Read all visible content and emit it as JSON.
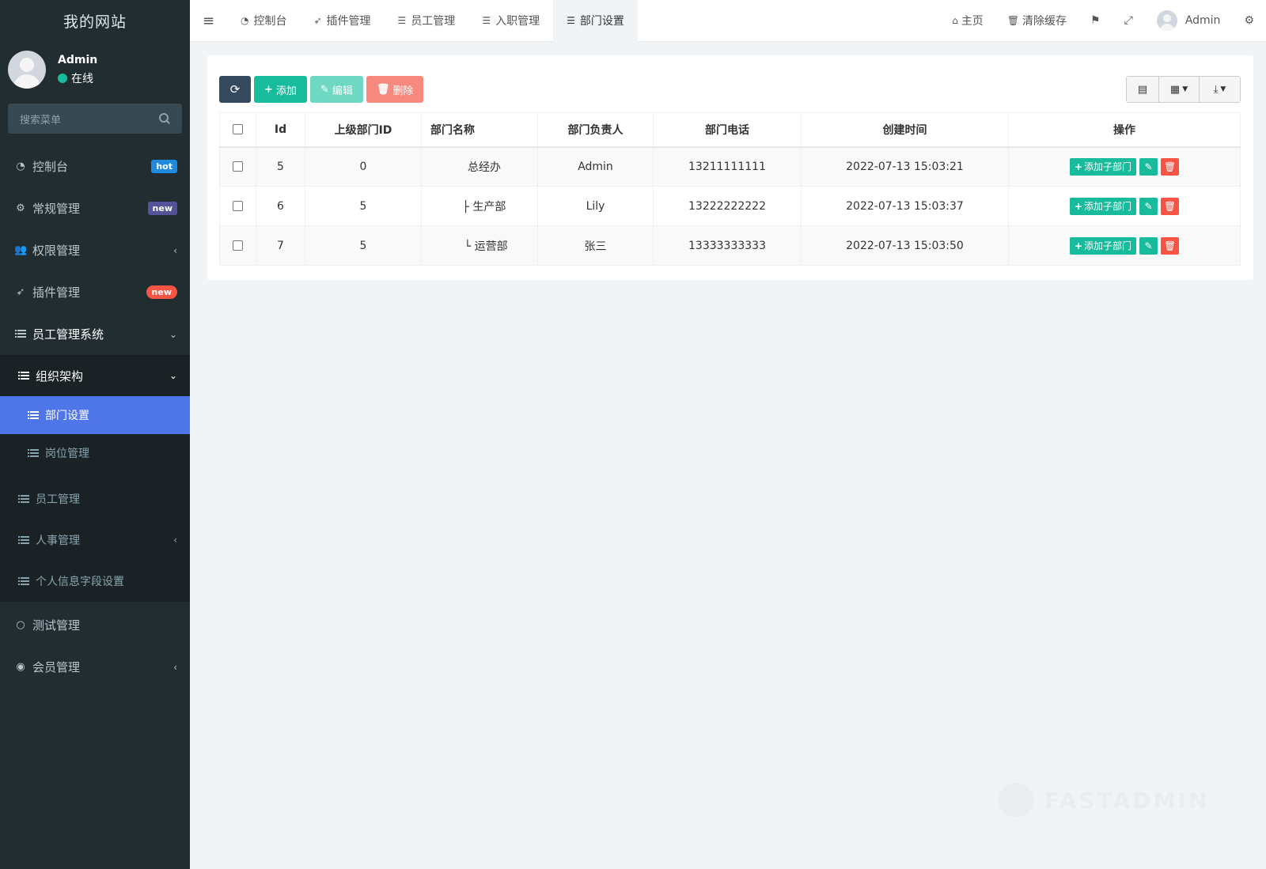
{
  "site": {
    "title": "我的网站"
  },
  "user": {
    "name": "Admin",
    "status": "在线"
  },
  "search": {
    "placeholder": "搜索菜单"
  },
  "sidebar": {
    "items": [
      {
        "label": "控制台",
        "icon": "dashboard-icon",
        "badge": "hot"
      },
      {
        "label": "常规管理",
        "icon": "cogs-icon",
        "badge": "new"
      },
      {
        "label": "权限管理",
        "icon": "group-icon"
      },
      {
        "label": "插件管理",
        "icon": "rocket-icon",
        "badge": "new"
      },
      {
        "label": "员工管理系统",
        "icon": "list-icon"
      }
    ],
    "tree": {
      "group": "组织架构",
      "children": [
        "部门设置",
        "岗位管理"
      ],
      "others": [
        "员工管理",
        "人事管理",
        "个人信息字段设置"
      ]
    },
    "bottom": [
      {
        "label": "测试管理",
        "icon": "circle-icon"
      },
      {
        "label": "会员管理",
        "icon": "user-circle-icon"
      }
    ]
  },
  "topbar": {
    "tabs": [
      "控制台",
      "插件管理",
      "员工管理",
      "入职管理",
      "部门设置"
    ],
    "home": "主页",
    "clear_cache": "清除缓存",
    "user": "Admin"
  },
  "toolbar": {
    "add": "添加",
    "edit": "编辑",
    "delete": "删除"
  },
  "table": {
    "headers": [
      "Id",
      "上级部门ID",
      "部门名称",
      "部门负责人",
      "部门电话",
      "创建时间",
      "操作"
    ],
    "rows": [
      {
        "id": "5",
        "pid": "0",
        "name": "总经办",
        "leader": "Admin",
        "phone": "13211111111",
        "created": "2022-07-13 15:03:21"
      },
      {
        "id": "6",
        "pid": "5",
        "name": "├ 生产部",
        "leader": "Lily",
        "phone": "13222222222",
        "created": "2022-07-13 15:03:37"
      },
      {
        "id": "7",
        "pid": "5",
        "name": " └ 运营部",
        "leader": "张三",
        "phone": "13333333333",
        "created": "2022-07-13 15:03:50"
      }
    ],
    "add_child_label": "添加子部门"
  },
  "watermark": "FASTADMIN",
  "colors": {
    "sidebar_bg": "#222d32",
    "active": "#4f76e8",
    "success": "#18bc9c",
    "danger": "#f75444"
  }
}
